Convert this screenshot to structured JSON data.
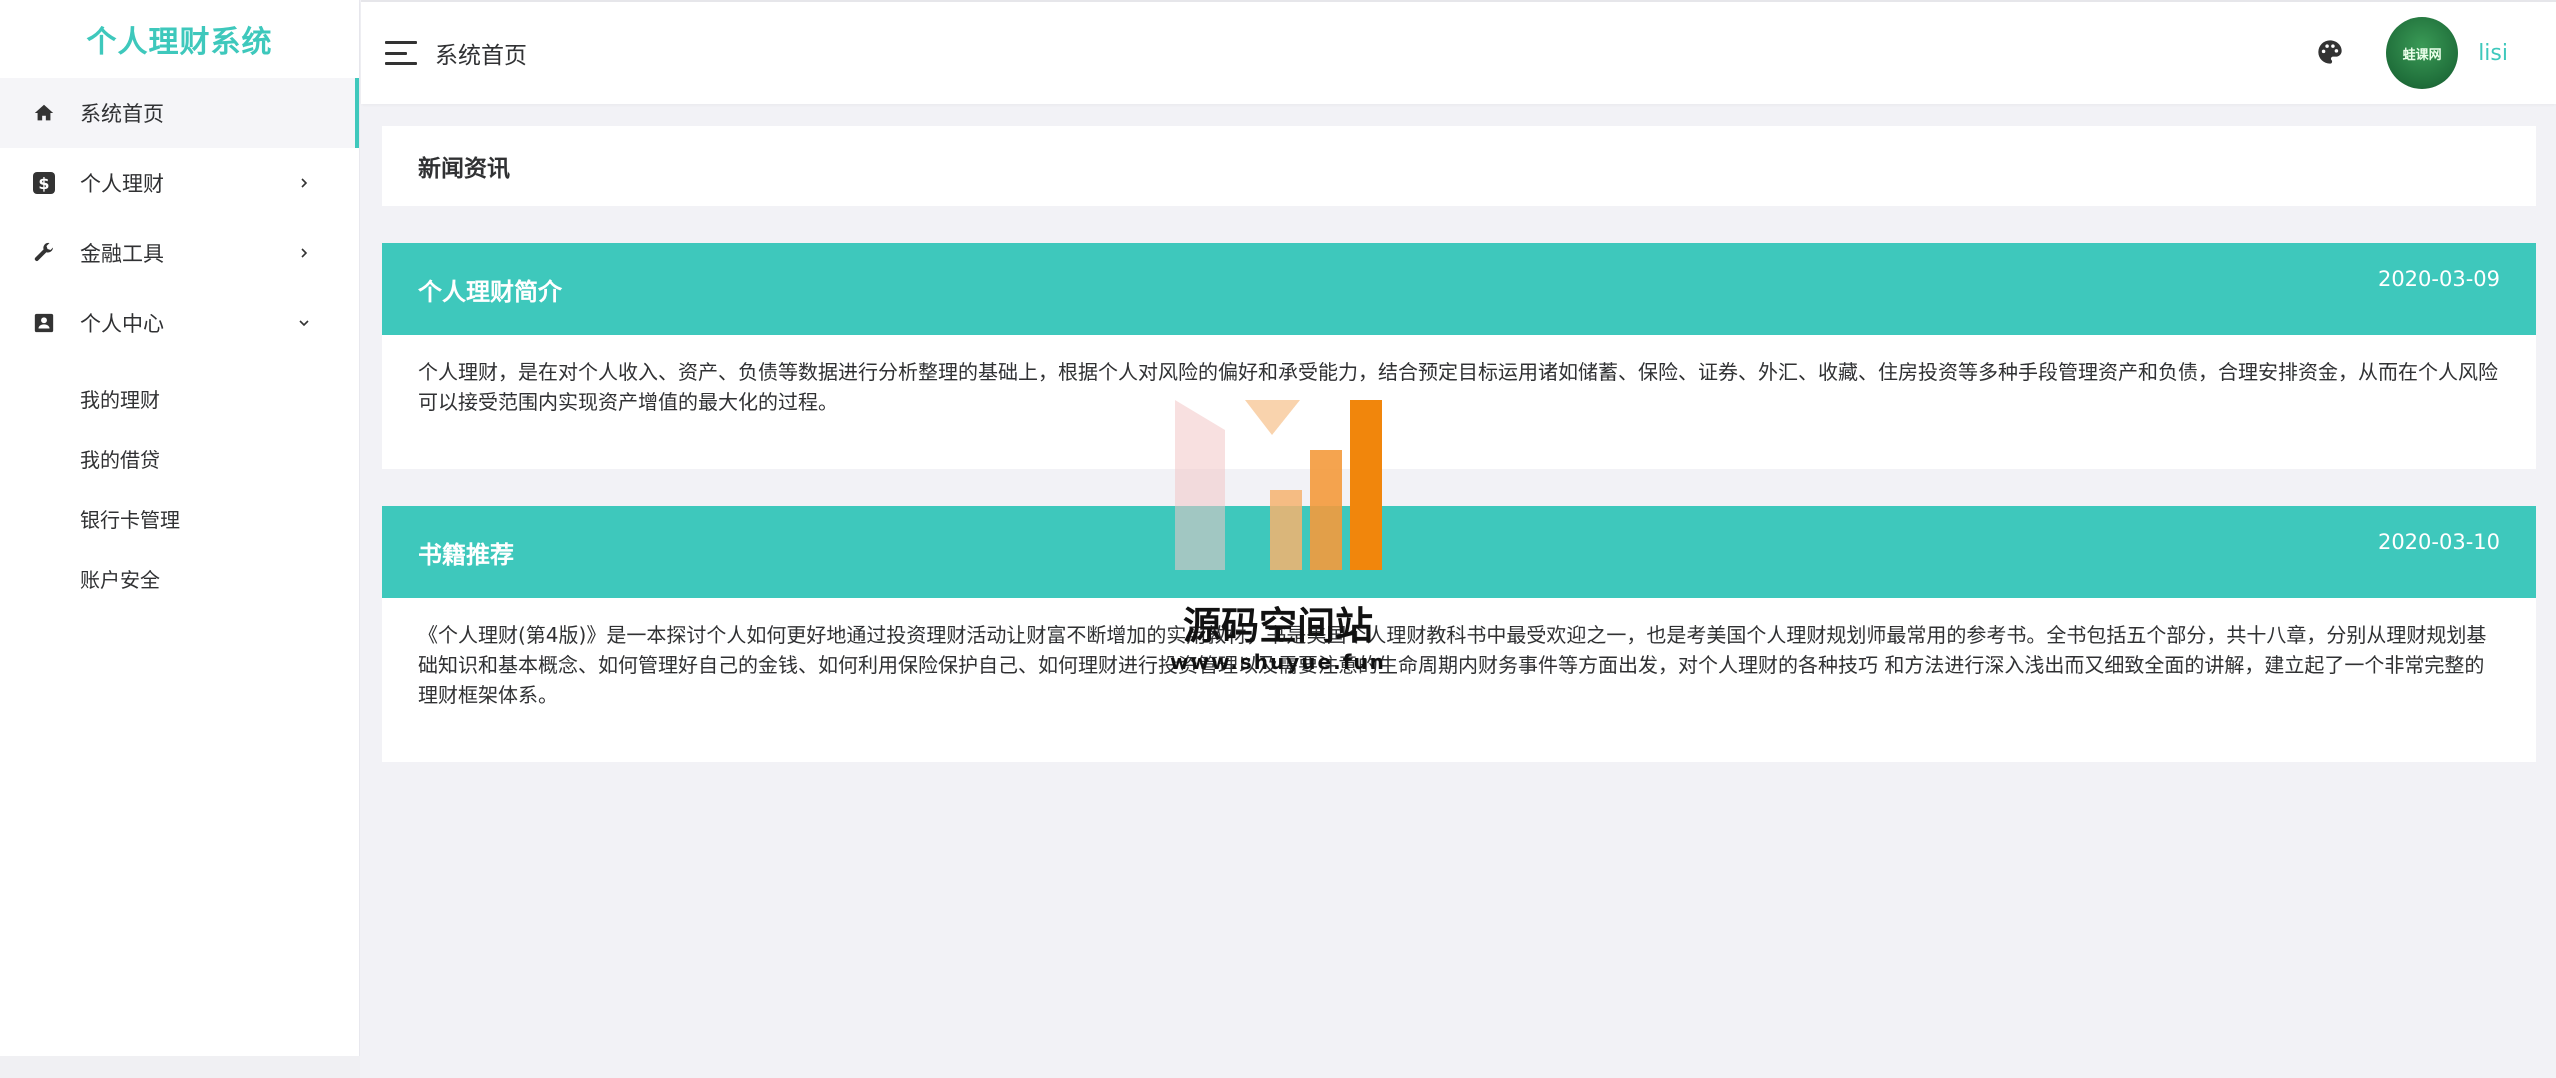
{
  "app": {
    "brand": "个人理财系统"
  },
  "sidebar": {
    "items": [
      {
        "label": "系统首页",
        "icon": "home-icon",
        "active": true
      },
      {
        "label": "个人理财",
        "icon": "dollar-icon"
      },
      {
        "label": "金融工具",
        "icon": "wrench-icon"
      },
      {
        "label": "个人中心",
        "icon": "contact-icon",
        "expanded": true
      }
    ],
    "submenu": [
      "我的理财",
      "我的借贷",
      "银行卡管理",
      "账户安全"
    ]
  },
  "header": {
    "title": "系统首页",
    "username": "lisi",
    "avatar_text": "蛙课网"
  },
  "main": {
    "news_title": "新闻资讯",
    "articles": [
      {
        "title": "个人理财简介",
        "date": "2020-03-09",
        "body": "个人理财，是在对个人收入、资产、负债等数据进行分析整理的基础上，根据个人对风险的偏好和承受能力，结合预定目标运用诸如储蓄、保险、证券、外汇、收藏、住房投资等多种手段管理资产和负债，合理安排资金，从而在个人风险可以接受范围内实现资产增值的最大化的过程。"
      },
      {
        "title": "书籍推荐",
        "date": "2020-03-10",
        "body": "《个人理财(第4版)》是一本探讨个人如何更好地通过投资理财活动让财富不断增加的实用教材，书是美国个人理财教科书中最受欢迎之一，也是考美国个人理财规划师最常用的参考书。全书包括五个部分，共十八章，分别从理财规划基础知识和基本概念、如何管理好自己的金钱、如何利用保险保护自己、如何理财进行投资管理以及需要注意的生命周期内财务事件等方面出发，对个人理财的各种技巧 和方法进行深入浅出而又细致全面的讲解，建立起了一个非常完整的理财框架体系。"
      }
    ]
  },
  "watermark": {
    "text": "源码空间站",
    "url": "www.shuyue.fun"
  },
  "colors": {
    "accent": "#3ec8bc",
    "background": "#f2f2f6"
  }
}
